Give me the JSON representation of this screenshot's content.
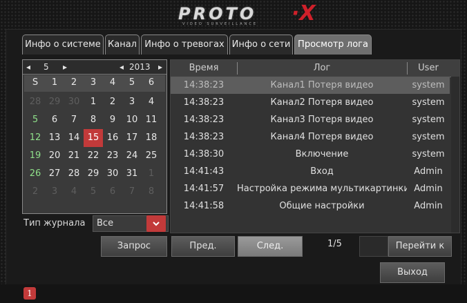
{
  "logo": {
    "brand": "PROTO",
    "mark": "·X",
    "tagline": "VIDEO SURVEILLANCE"
  },
  "tabs": [
    {
      "label": "Инфо о системе"
    },
    {
      "label": "Канал"
    },
    {
      "label": "Инфо о тревогах"
    },
    {
      "label": "Инфо о сети"
    },
    {
      "label": "Просмотр лога",
      "active": true
    }
  ],
  "calendar": {
    "month": "5",
    "year": "2013",
    "month_prev": "◂",
    "month_next": "▸",
    "year_prev": "◂",
    "year_next": "▸",
    "weekdays": [
      "S",
      "1",
      "2",
      "3",
      "4",
      "5",
      "6"
    ],
    "days": [
      [
        "28",
        "29",
        "30",
        "1",
        "2",
        "3",
        "4"
      ],
      [
        "5",
        "6",
        "7",
        "8",
        "9",
        "10",
        "11"
      ],
      [
        "12",
        "13",
        "14",
        "15",
        "16",
        "17",
        "18"
      ],
      [
        "19",
        "20",
        "21",
        "22",
        "23",
        "24",
        "25"
      ],
      [
        "26",
        "27",
        "28",
        "29",
        "30",
        "31",
        "1"
      ],
      [
        "2",
        "3",
        "4",
        "5",
        "6",
        "7",
        "8"
      ]
    ],
    "selected_day": "15"
  },
  "journal_type": {
    "label": "Тип журнала",
    "value": "Все"
  },
  "buttons": {
    "query": "Запрос",
    "prev": "Пред.",
    "next": "След.",
    "goto": "Перейти к",
    "exit": "Выход"
  },
  "log": {
    "columns": [
      "Время",
      "Лог",
      "User"
    ],
    "rows": [
      {
        "time": "14:38:23",
        "event": "Канал1 Потеря видео",
        "user": "system"
      },
      {
        "time": "14:38:23",
        "event": "Канал2 Потеря видео",
        "user": "system"
      },
      {
        "time": "14:38:23",
        "event": "Канал3 Потеря видео",
        "user": "system"
      },
      {
        "time": "14:38:23",
        "event": "Канал4 Потеря видео",
        "user": "system"
      },
      {
        "time": "14:38:30",
        "event": "Включение",
        "user": "system"
      },
      {
        "time": "14:41:43",
        "event": "Вход",
        "user": "Admin"
      },
      {
        "time": "14:41:57",
        "event": "Настройка режима мультикартинки",
        "user": "Admin"
      },
      {
        "time": "14:41:58",
        "event": "Общие настройки",
        "user": "Admin"
      }
    ],
    "selected_row": 0
  },
  "pagination": {
    "page": "1/5"
  },
  "status": {
    "alarm_icon": "1"
  }
}
